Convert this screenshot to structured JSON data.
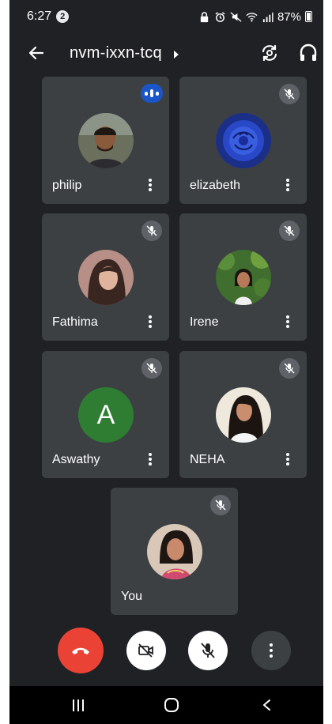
{
  "status_bar": {
    "time": "6:27",
    "notification_count": "2",
    "battery": "87%"
  },
  "app_bar": {
    "meeting_code": "nvm-ixxn-tcq"
  },
  "participants": [
    {
      "name": "philip",
      "status": "speaking",
      "avatar": "photo"
    },
    {
      "name": "elizabeth",
      "status": "muted",
      "avatar": "photo"
    },
    {
      "name": "Fathima",
      "status": "muted",
      "avatar": "photo"
    },
    {
      "name": "Irene",
      "status": "muted",
      "avatar": "photo"
    },
    {
      "name": "Aswathy",
      "status": "muted",
      "avatar": "letter",
      "initial": "A",
      "avatar_color": "#2e7d32"
    },
    {
      "name": "NEHA",
      "status": "muted",
      "avatar": "photo"
    },
    {
      "name": "You",
      "status": "muted",
      "avatar": "photo"
    }
  ],
  "controls": {
    "end_call": "end-call-icon",
    "camera": "camera-off-icon",
    "microphone": "mic-off-icon",
    "more": "more-vert-icon"
  },
  "colors": {
    "background": "#202124",
    "tile": "#3c4043",
    "end_call": "#ea4335",
    "speaking": "#1a56c8"
  }
}
